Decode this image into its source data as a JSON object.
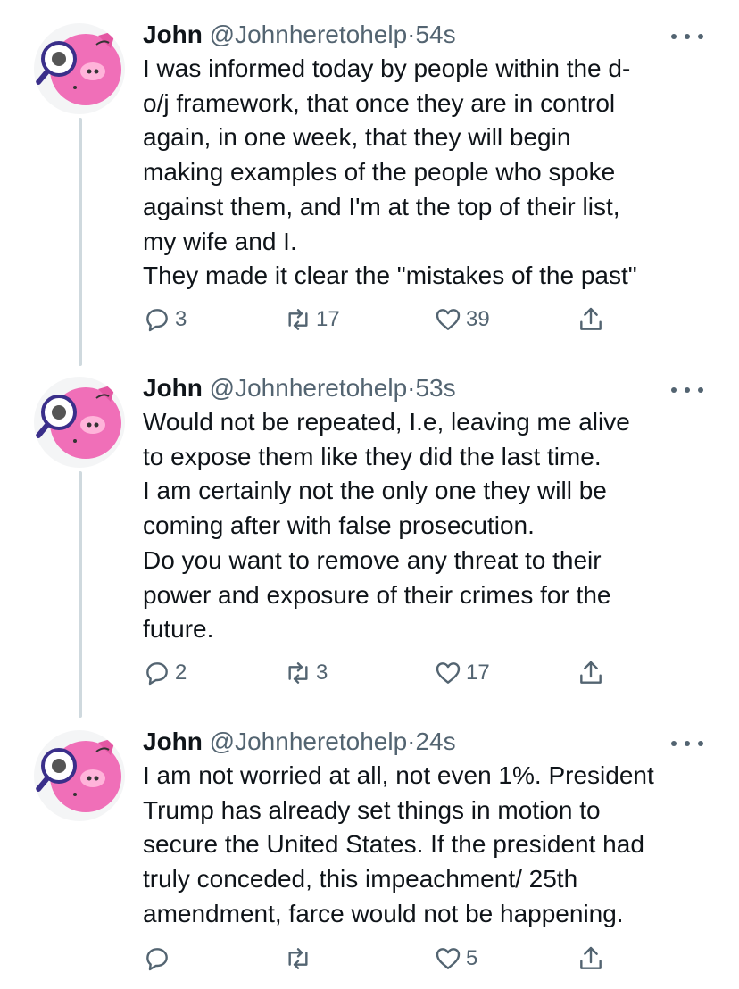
{
  "tweets": [
    {
      "name": "John",
      "handle": "@Johnheretohelp",
      "separator": "·",
      "time": "54s",
      "lines": [
        "I was informed today by people within the d-",
        "o/j framework, that once they are in control",
        "again, in one week, that they will begin",
        "making examples of the people who spoke",
        "against them, and I'm at the top of their list,",
        "my wife and I.",
        "They made it clear the \"mistakes of the past\""
      ],
      "replies": "3",
      "retweets": "17",
      "likes": "39"
    },
    {
      "name": "John",
      "handle": "@Johnheretohelp",
      "separator": "·",
      "time": "53s",
      "lines": [
        "Would not be repeated, I.e, leaving me alive",
        "to expose them like they did the last time.",
        "I am certainly not the only one they will be",
        "coming after with false prosecution.",
        "Do you want to remove any threat to their",
        "power and exposure of their crimes for the",
        "future."
      ],
      "replies": "2",
      "retweets": "3",
      "likes": "17"
    },
    {
      "name": "John",
      "handle": "@Johnheretohelp",
      "separator": "·",
      "time": "24s",
      "lines": [
        "I am not worried at all, not even 1%. President",
        "Trump has already set things in motion to",
        "secure the United States. If the president had",
        "truly conceded, this impeachment/ 25th",
        "amendment, farce would not be happening."
      ],
      "replies": "",
      "retweets": "",
      "likes": "5"
    }
  ],
  "icons": {
    "reply": "reply-icon",
    "retweet": "retweet-icon",
    "like": "heart-icon",
    "share": "share-icon",
    "more": "more-icon"
  },
  "colors": {
    "text": "#0f1419",
    "secondary": "#536471",
    "thread_line": "#cfd9de",
    "avatar_pig": "#f06fb8"
  }
}
